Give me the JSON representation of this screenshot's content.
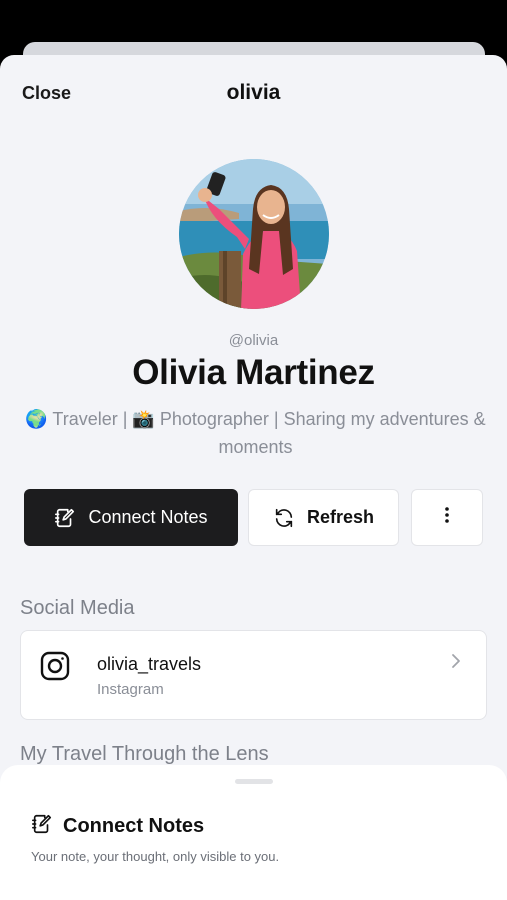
{
  "header": {
    "close_label": "Close",
    "title": "olivia"
  },
  "profile": {
    "handle": "@olivia",
    "name": "Olivia Martinez",
    "bio": "🌍 Traveler | 📸 Photographer | Sharing my adventures & moments"
  },
  "actions": {
    "connect_label": "Connect Notes",
    "refresh_label": "Refresh"
  },
  "social": {
    "section_title": "Social Media",
    "items": [
      {
        "handle": "olivia_travels",
        "platform": "Instagram"
      }
    ]
  },
  "gallery": {
    "section_title": "My Travel Through the Lens"
  },
  "notes_sheet": {
    "title": "Connect Notes",
    "subtitle": "Your note, your thought, only visible to you."
  }
}
